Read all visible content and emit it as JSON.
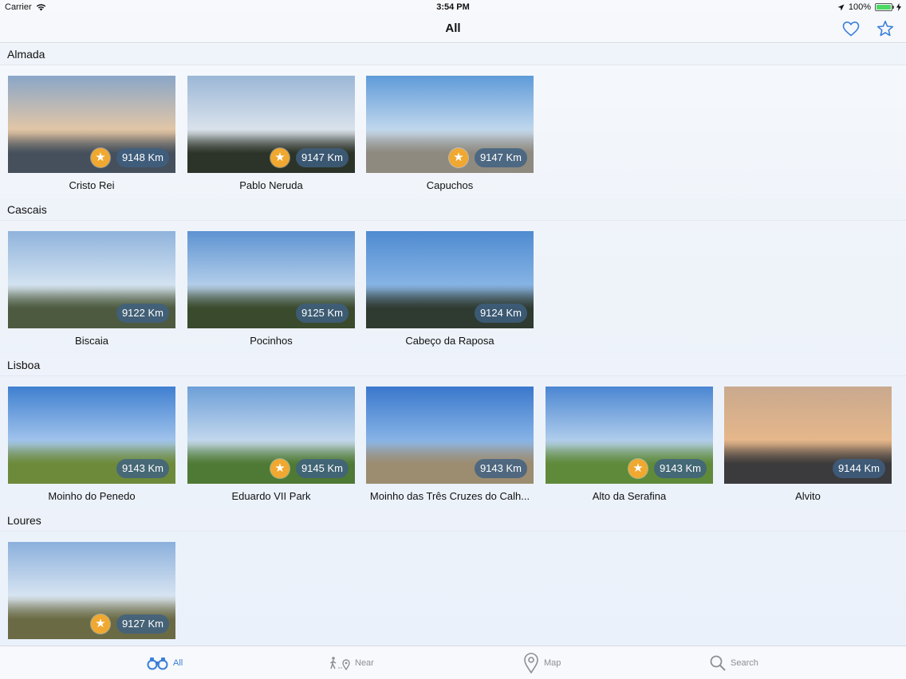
{
  "status_bar": {
    "carrier": "Carrier",
    "time": "3:54 PM",
    "battery": "100%"
  },
  "nav": {
    "title": "All"
  },
  "sections": [
    {
      "name": "Almada",
      "places": [
        {
          "name": "Cristo Rei",
          "distance": "9148 Km",
          "favorite": true,
          "sky": "#8aa6c8",
          "sky2": "#e9c9a4",
          "ground": "#45505c"
        },
        {
          "name": "Pablo Neruda",
          "distance": "9147 Km",
          "favorite": true,
          "sky": "#9bb7d6",
          "sky2": "#dfe6ee",
          "ground": "#2c3328"
        },
        {
          "name": "Capuchos",
          "distance": "9147 Km",
          "favorite": true,
          "sky": "#5f9bd9",
          "sky2": "#c8dcee",
          "ground": "#8e8a80"
        }
      ]
    },
    {
      "name": "Cascais",
      "places": [
        {
          "name": "Biscaia",
          "distance": "9122 Km",
          "favorite": false,
          "sky": "#8fb3dc",
          "sky2": "#d8e6f2",
          "ground": "#4d5a3f"
        },
        {
          "name": "Pocinhos",
          "distance": "9125 Km",
          "favorite": false,
          "sky": "#5d93d2",
          "sky2": "#b9d2ec",
          "ground": "#3a4a2c"
        },
        {
          "name": "Cabeço da Raposa",
          "distance": "9124 Km",
          "favorite": false,
          "sky": "#4f8bd0",
          "sky2": "#8ab7e6",
          "ground": "#2f3a30"
        }
      ]
    },
    {
      "name": "Lisboa",
      "places": [
        {
          "name": "Moinho do Penedo",
          "distance": "9143 Km",
          "favorite": false,
          "sky": "#3f7fd0",
          "sky2": "#a8c9ee",
          "ground": "#6d8a3a"
        },
        {
          "name": "Eduardo VII Park",
          "distance": "9145 Km",
          "favorite": true,
          "sky": "#6d9fd8",
          "sky2": "#c9dcef",
          "ground": "#4f7a35"
        },
        {
          "name": "Moinho das Três Cruzes do Calh...",
          "distance": "9143 Km",
          "favorite": false,
          "sky": "#3a78cc",
          "sky2": "#8db8e8",
          "ground": "#9c8c70"
        },
        {
          "name": "Alto da Serafina",
          "distance": "9143 Km",
          "favorite": true,
          "sky": "#4b86d2",
          "sky2": "#b8d3ee",
          "ground": "#5f8a3a"
        },
        {
          "name": "Alvito",
          "distance": "9144 Km",
          "favorite": false,
          "sky": "#c9a98e",
          "sky2": "#e8b88a",
          "ground": "#3b3a3c"
        }
      ]
    },
    {
      "name": "Loures",
      "places": [
        {
          "name": "",
          "distance": "9127 Km",
          "favorite": true,
          "sky": "#8bb0dc",
          "sky2": "#dde8f3",
          "ground": "#6a6b45"
        }
      ]
    }
  ],
  "tabs": [
    {
      "label": "All",
      "icon": "binoculars-icon",
      "active": true
    },
    {
      "label": "Near",
      "icon": "walker-pin-icon",
      "active": false
    },
    {
      "label": "Map",
      "icon": "map-pin-icon",
      "active": false
    },
    {
      "label": "Search",
      "icon": "search-icon",
      "active": false
    }
  ],
  "colors": {
    "accent": "#3b7fd9",
    "star_badge": "#f0a830",
    "distance_badge": "#3e6082"
  }
}
